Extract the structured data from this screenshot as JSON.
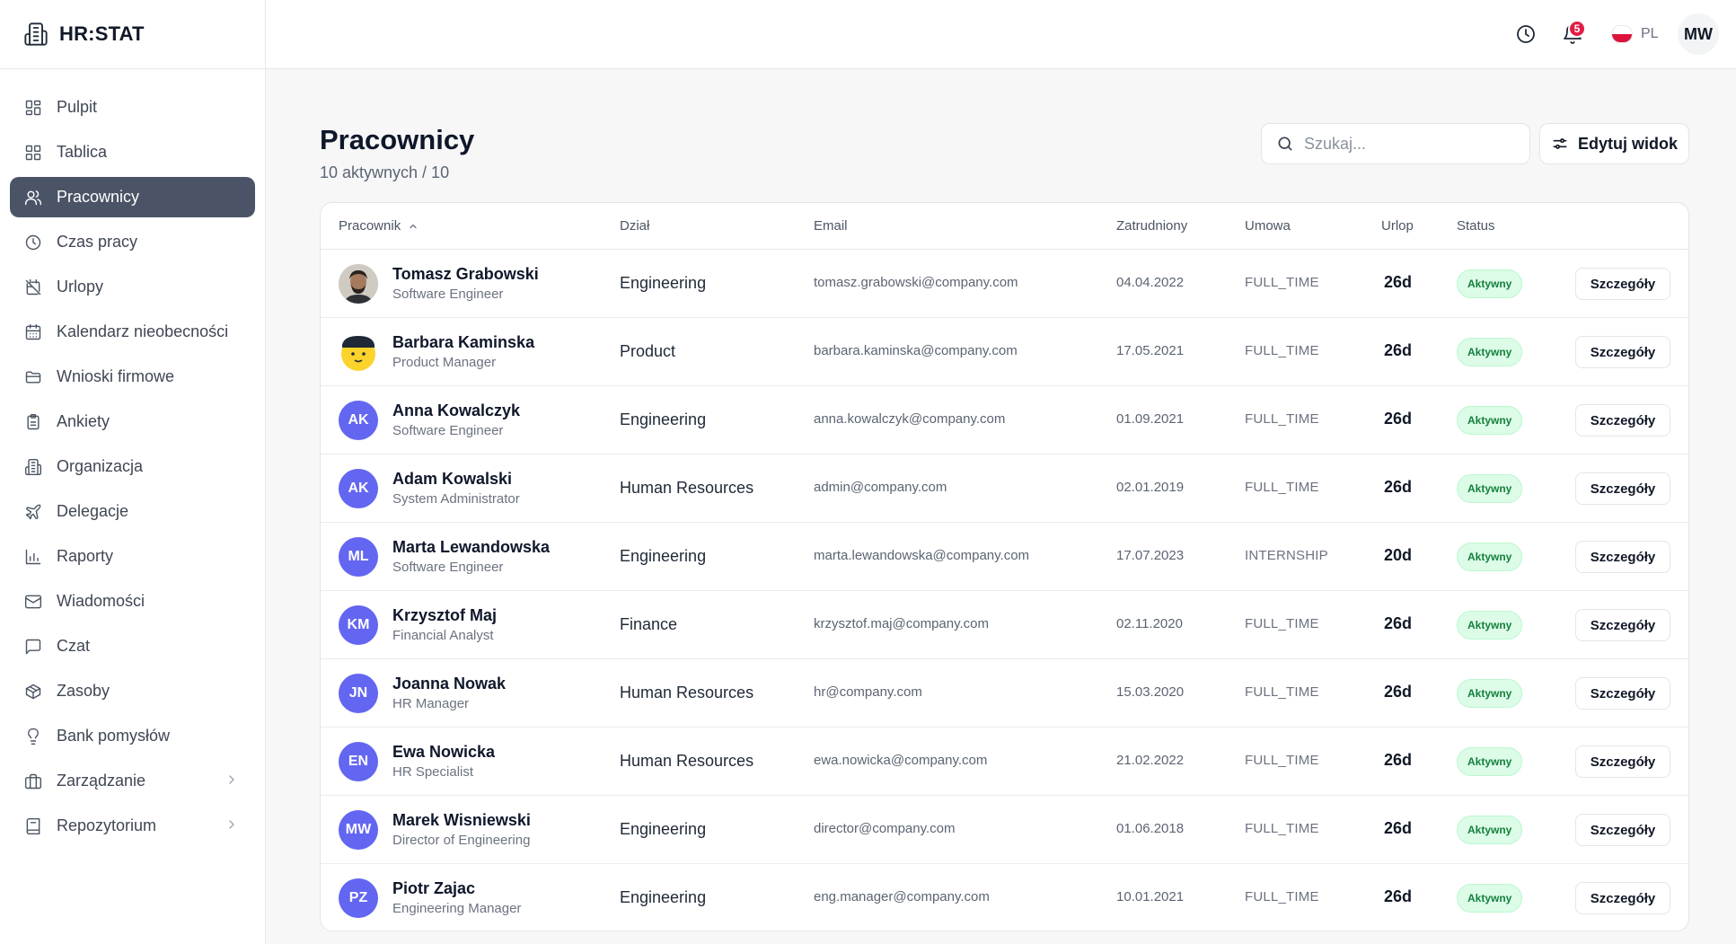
{
  "brand": {
    "name": "HR:STAT"
  },
  "sidebar": {
    "items": [
      {
        "label": "Pulpit",
        "icon": "dashboard-icon"
      },
      {
        "label": "Tablica",
        "icon": "board-icon"
      },
      {
        "label": "Pracownicy",
        "icon": "users-icon",
        "active": true
      },
      {
        "label": "Czas pracy",
        "icon": "clock-icon"
      },
      {
        "label": "Urlopy",
        "icon": "calendar-off-icon"
      },
      {
        "label": "Kalendarz nieobecności",
        "icon": "calendar-icon"
      },
      {
        "label": "Wnioski firmowe",
        "icon": "folder-icon"
      },
      {
        "label": "Ankiety",
        "icon": "clipboard-icon"
      },
      {
        "label": "Organizacja",
        "icon": "building-icon"
      },
      {
        "label": "Delegacje",
        "icon": "plane-icon"
      },
      {
        "label": "Raporty",
        "icon": "bar-chart-icon"
      },
      {
        "label": "Wiadomości",
        "icon": "mail-icon"
      },
      {
        "label": "Czat",
        "icon": "chat-icon"
      },
      {
        "label": "Zasoby",
        "icon": "package-icon"
      },
      {
        "label": "Bank pomysłów",
        "icon": "lightbulb-icon"
      },
      {
        "label": "Zarządzanie",
        "icon": "briefcase-icon",
        "expandable": true
      },
      {
        "label": "Repozytorium",
        "icon": "book-icon",
        "expandable": true
      }
    ]
  },
  "topbar": {
    "notifications_count": "5",
    "language": "PL",
    "user_initials": "MW"
  },
  "header": {
    "title": "Pracownicy",
    "subtitle": "10 aktywnych / 10",
    "search_placeholder": "Szukaj...",
    "edit_view_label": "Edytuj widok"
  },
  "table": {
    "columns": [
      "Pracownik",
      "Dział",
      "Email",
      "Zatrudniony",
      "Umowa",
      "Urlop",
      "Status"
    ],
    "details_label": "Szczegóły",
    "rows": [
      {
        "name": "Tomasz Grabowski",
        "role": "Software Engineer",
        "department": "Engineering",
        "email": "tomasz.grabowski@company.com",
        "hired": "04.04.2022",
        "contract": "FULL_TIME",
        "leave": "26d",
        "status": "Aktywny",
        "initials": "",
        "avatar": "photo-man"
      },
      {
        "name": "Barbara Kaminska",
        "role": "Product Manager",
        "department": "Product",
        "email": "barbara.kaminska@company.com",
        "hired": "17.05.2021",
        "contract": "FULL_TIME",
        "leave": "26d",
        "status": "Aktywny",
        "initials": "",
        "avatar": "emoji-face"
      },
      {
        "name": "Anna Kowalczyk",
        "role": "Software Engineer",
        "department": "Engineering",
        "email": "anna.kowalczyk@company.com",
        "hired": "01.09.2021",
        "contract": "FULL_TIME",
        "leave": "26d",
        "status": "Aktywny",
        "initials": "AK",
        "avatar": "initials"
      },
      {
        "name": "Adam Kowalski",
        "role": "System Administrator",
        "department": "Human Resources",
        "email": "admin@company.com",
        "hired": "02.01.2019",
        "contract": "FULL_TIME",
        "leave": "26d",
        "status": "Aktywny",
        "initials": "AK",
        "avatar": "initials"
      },
      {
        "name": "Marta Lewandowska",
        "role": "Software Engineer",
        "department": "Engineering",
        "email": "marta.lewandowska@company.com",
        "hired": "17.07.2023",
        "contract": "INTERNSHIP",
        "leave": "20d",
        "status": "Aktywny",
        "initials": "ML",
        "avatar": "initials"
      },
      {
        "name": "Krzysztof Maj",
        "role": "Financial Analyst",
        "department": "Finance",
        "email": "krzysztof.maj@company.com",
        "hired": "02.11.2020",
        "contract": "FULL_TIME",
        "leave": "26d",
        "status": "Aktywny",
        "initials": "KM",
        "avatar": "initials"
      },
      {
        "name": "Joanna Nowak",
        "role": "HR Manager",
        "department": "Human Resources",
        "email": "hr@company.com",
        "hired": "15.03.2020",
        "contract": "FULL_TIME",
        "leave": "26d",
        "status": "Aktywny",
        "initials": "JN",
        "avatar": "initials"
      },
      {
        "name": "Ewa Nowicka",
        "role": "HR Specialist",
        "department": "Human Resources",
        "email": "ewa.nowicka@company.com",
        "hired": "21.02.2022",
        "contract": "FULL_TIME",
        "leave": "26d",
        "status": "Aktywny",
        "initials": "EN",
        "avatar": "initials"
      },
      {
        "name": "Marek Wisniewski",
        "role": "Director of Engineering",
        "department": "Engineering",
        "email": "director@company.com",
        "hired": "01.06.2018",
        "contract": "FULL_TIME",
        "leave": "26d",
        "status": "Aktywny",
        "initials": "MW",
        "avatar": "initials"
      },
      {
        "name": "Piotr Zajac",
        "role": "Engineering Manager",
        "department": "Engineering",
        "email": "eng.manager@company.com",
        "hired": "10.01.2021",
        "contract": "FULL_TIME",
        "leave": "26d",
        "status": "Aktywny",
        "initials": "PZ",
        "avatar": "initials"
      }
    ]
  },
  "colors": {
    "active_nav_bg": "#4b5466",
    "avatar_bg": "#6366f1",
    "status_bg": "#dcfce7",
    "status_text": "#15803d",
    "badge": "#e11d48"
  }
}
